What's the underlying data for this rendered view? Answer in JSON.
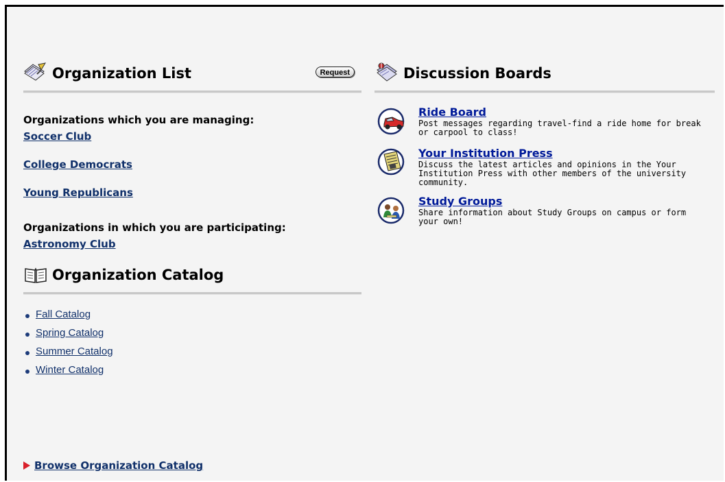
{
  "org_list": {
    "title": "Organization List",
    "request_label": "Request",
    "managing_label": "Organizations which you are managing:",
    "managing": [
      "Soccer Club",
      "College Democrats",
      "Young Republicans"
    ],
    "participating_label": "Organizations in which you are participating:",
    "participating": [
      "Astronomy Club"
    ]
  },
  "catalog": {
    "title": "Organization Catalog",
    "items": [
      "Fall Catalog",
      "Spring Catalog",
      "Summer Catalog",
      "Winter Catalog"
    ]
  },
  "boards": {
    "title": "Discussion Boards",
    "items": [
      {
        "title": "Ride Board",
        "desc": "Post messages regarding travel-find a ride home for break or carpool to class!",
        "icon": "car-icon"
      },
      {
        "title": "Your Institution Press",
        "desc": "Discuss the latest articles and opinions in the Your Institution Press with other members of the university community.",
        "icon": "newspaper-icon"
      },
      {
        "title": "Study Groups",
        "desc": "Share information about Study Groups on campus or form your own!",
        "icon": "study-group-icon"
      }
    ]
  },
  "browse_label": "Browse Organization Catalog",
  "colors": {
    "link": "#10306a",
    "board_link": "#001a99",
    "arrow": "#d9202a",
    "rule": "#c8c8c8"
  }
}
